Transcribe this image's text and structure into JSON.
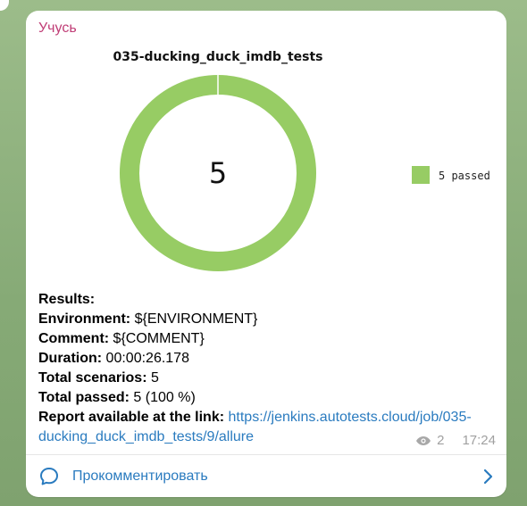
{
  "channel": {
    "name": "Учусь"
  },
  "colors": {
    "passed": "#97cc64",
    "channel_name": "#c03d76",
    "link": "#2a7bbf"
  },
  "chart_data": {
    "type": "pie",
    "title": "035-ducking_duck_imdb_tests",
    "center_label": "5",
    "slices": [
      {
        "label": "5 passed",
        "value": 5
      }
    ]
  },
  "message": {
    "results_label": "Results:",
    "environment_label": "Environment:",
    "environment_value": " ${ENVIRONMENT}",
    "comment_label": "Comment:",
    "comment_value": " ${COMMENT}",
    "duration_label": "Duration:",
    "duration_value": " 00:00:26.178",
    "scenarios_label": "Total scenarios:",
    "scenarios_value": " 5",
    "passed_label": "Total passed:",
    "passed_value": " 5 (100 %)",
    "report_label": "Report available at the link:",
    "report_link_line1": "https://jenkins.autotests.cloud/job/035-",
    "report_link_line2": "ducking_duck_imdb_tests/9/allure"
  },
  "meta": {
    "views": "2",
    "time": "17:24"
  },
  "footer": {
    "comment_button": "Прокомментировать"
  }
}
